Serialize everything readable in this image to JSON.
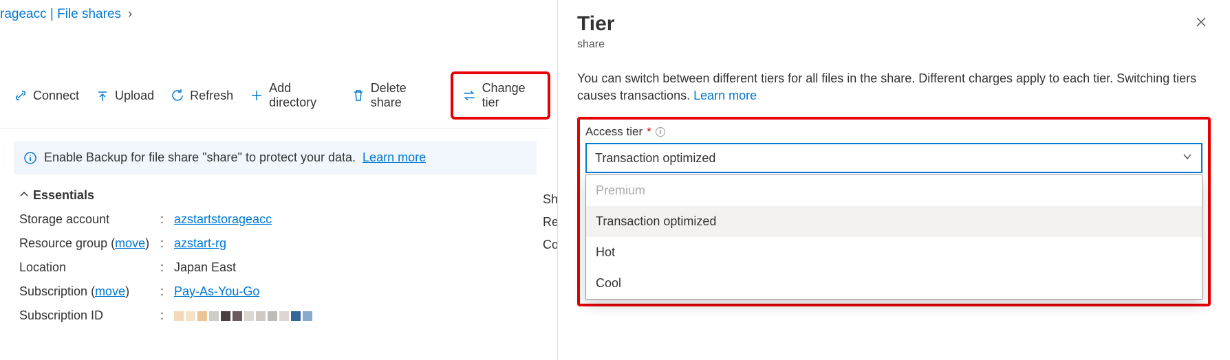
{
  "breadcrumb": {
    "text": "rageacc | File shares"
  },
  "toolbar": {
    "connect": "Connect",
    "upload": "Upload",
    "refresh": "Refresh",
    "add_directory": "Add directory",
    "delete_share": "Delete share",
    "change_tier": "Change tier"
  },
  "banner": {
    "text": "Enable Backup for file share \"share\" to protect your data.",
    "learn_more": "Learn more"
  },
  "essentials": {
    "title": "Essentials",
    "storage_account_label": "Storage account",
    "storage_account_value": "azstartstorageacc",
    "resource_group_label": "Resource group",
    "resource_group_move": "move",
    "resource_group_value": "azstart-rg",
    "location_label": "Location",
    "location_value": "Japan East",
    "subscription_label": "Subscription",
    "subscription_move": "move",
    "subscription_value": "Pay-As-You-Go",
    "subscription_id_label": "Subscription ID"
  },
  "right_trunc": {
    "r1": "Sh",
    "r2": "Re",
    "r3": "Co"
  },
  "panel": {
    "title": "Tier",
    "subtitle": "share",
    "desc": "You can switch between different tiers for all files in the share. Different charges apply to each tier. Switching tiers causes transactions.",
    "learn_more": "Learn more",
    "field_label": "Access tier",
    "value": "Transaction optimized",
    "options": {
      "premium": "Premium",
      "transaction": "Transaction optimized",
      "hot": "Hot",
      "cool": "Cool"
    }
  }
}
